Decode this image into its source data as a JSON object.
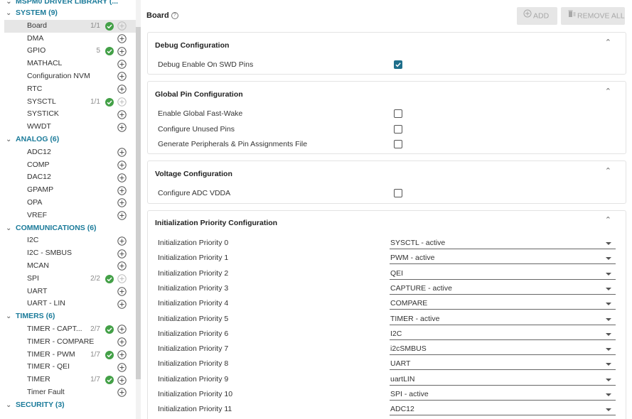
{
  "sidebar": {
    "library_title": "MSPM0 DRIVER LIBRARY (...",
    "categories": [
      {
        "name": "SYSTEM (9)",
        "items": [
          {
            "label": "Board",
            "count": "1/1",
            "ok": true,
            "add_dim": true,
            "selected": true
          },
          {
            "label": "DMA",
            "count": "",
            "ok": false,
            "add_dim": false
          },
          {
            "label": "GPIO",
            "count": "5",
            "ok": true,
            "add_dim": false
          },
          {
            "label": "MATHACL",
            "count": "",
            "ok": false,
            "add_dim": false
          },
          {
            "label": "Configuration NVM",
            "count": "",
            "ok": false,
            "add_dim": false
          },
          {
            "label": "RTC",
            "count": "",
            "ok": false,
            "add_dim": false
          },
          {
            "label": "SYSCTL",
            "count": "1/1",
            "ok": true,
            "add_dim": true
          },
          {
            "label": "SYSTICK",
            "count": "",
            "ok": false,
            "add_dim": false
          },
          {
            "label": "WWDT",
            "count": "",
            "ok": false,
            "add_dim": false
          }
        ]
      },
      {
        "name": "ANALOG (6)",
        "items": [
          {
            "label": "ADC12",
            "count": "",
            "ok": false,
            "add_dim": false
          },
          {
            "label": "COMP",
            "count": "",
            "ok": false,
            "add_dim": false
          },
          {
            "label": "DAC12",
            "count": "",
            "ok": false,
            "add_dim": false
          },
          {
            "label": "GPAMP",
            "count": "",
            "ok": false,
            "add_dim": false
          },
          {
            "label": "OPA",
            "count": "",
            "ok": false,
            "add_dim": false
          },
          {
            "label": "VREF",
            "count": "",
            "ok": false,
            "add_dim": false
          }
        ]
      },
      {
        "name": "COMMUNICATIONS (6)",
        "items": [
          {
            "label": "I2C",
            "count": "",
            "ok": false,
            "add_dim": false
          },
          {
            "label": "I2C - SMBUS",
            "count": "",
            "ok": false,
            "add_dim": false
          },
          {
            "label": "MCAN",
            "count": "",
            "ok": false,
            "add_dim": false
          },
          {
            "label": "SPI",
            "count": "2/2",
            "ok": true,
            "add_dim": true
          },
          {
            "label": "UART",
            "count": "",
            "ok": false,
            "add_dim": false
          },
          {
            "label": "UART - LIN",
            "count": "",
            "ok": false,
            "add_dim": false
          }
        ]
      },
      {
        "name": "TIMERS (6)",
        "items": [
          {
            "label": "TIMER - CAPT...",
            "count": "2/7",
            "ok": true,
            "add_dim": false
          },
          {
            "label": "TIMER - COMPARE",
            "count": "",
            "ok": false,
            "add_dim": false
          },
          {
            "label": "TIMER - PWM",
            "count": "1/7",
            "ok": true,
            "add_dim": false
          },
          {
            "label": "TIMER - QEI",
            "count": "",
            "ok": false,
            "add_dim": false
          },
          {
            "label": "TIMER",
            "count": "1/7",
            "ok": true,
            "add_dim": false
          },
          {
            "label": "Timer Fault",
            "count": "",
            "ok": false,
            "add_dim": false
          }
        ]
      },
      {
        "name": "SECURITY (3)",
        "items": []
      }
    ]
  },
  "header": {
    "title": "Board",
    "add_label": "ADD",
    "remove_all_label": "REMOVE ALL"
  },
  "panels": {
    "debug": {
      "title": "Debug Configuration",
      "rows": [
        {
          "label": "Debug Enable On SWD Pins",
          "checked": true
        }
      ]
    },
    "global_pin": {
      "title": "Global Pin Configuration",
      "rows": [
        {
          "label": "Enable Global Fast-Wake",
          "checked": false
        },
        {
          "label": "Configure Unused Pins",
          "checked": false
        },
        {
          "label": "Generate Peripherals & Pin Assignments File",
          "checked": false
        }
      ]
    },
    "voltage": {
      "title": "Voltage Configuration",
      "rows": [
        {
          "label": "Configure ADC VDDA",
          "checked": false
        }
      ]
    },
    "init_priority": {
      "title": "Initialization Priority Configuration",
      "rows": [
        {
          "label": "Initialization Priority 0",
          "value": "SYSCTL - active"
        },
        {
          "label": "Initialization Priority 1",
          "value": "PWM - active"
        },
        {
          "label": "Initialization Priority 2",
          "value": "QEI"
        },
        {
          "label": "Initialization Priority 3",
          "value": "CAPTURE - active"
        },
        {
          "label": "Initialization Priority 4",
          "value": "COMPARE"
        },
        {
          "label": "Initialization Priority 5",
          "value": "TIMER - active"
        },
        {
          "label": "Initialization Priority 6",
          "value": "I2C"
        },
        {
          "label": "Initialization Priority 7",
          "value": "i2cSMBUS"
        },
        {
          "label": "Initialization Priority 8",
          "value": "UART"
        },
        {
          "label": "Initialization Priority 9",
          "value": "uartLIN"
        },
        {
          "label": "Initialization Priority 10",
          "value": "SPI - active"
        },
        {
          "label": "Initialization Priority 11",
          "value": "ADC12"
        }
      ]
    }
  },
  "colors": {
    "category_text": "#1b7b9a",
    "check_ok": "#43a047",
    "checkbox_checked": "#1f6f8b"
  },
  "icons": [
    "chevron-down-icon",
    "check-circle-icon",
    "add-circle-icon",
    "help-icon",
    "delete-icon",
    "caret-up-icon",
    "dropdown-arrow-icon"
  ]
}
